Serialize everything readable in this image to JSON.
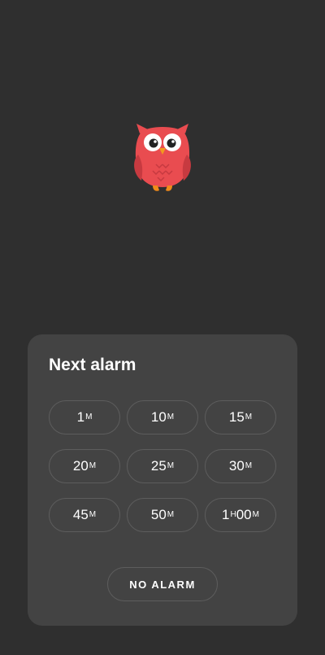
{
  "mascot": {
    "icon": "owl-icon",
    "colors": {
      "body": "#e94c50",
      "wing": "#c73a40",
      "beak": "#f39a1e",
      "feet": "#f08a1a"
    }
  },
  "sheet": {
    "title": "Next alarm",
    "options": [
      {
        "value": "1",
        "unit": "M"
      },
      {
        "value": "10",
        "unit": "M"
      },
      {
        "value": "15",
        "unit": "M"
      },
      {
        "value": "20",
        "unit": "M"
      },
      {
        "value": "25",
        "unit": "M"
      },
      {
        "value": "30",
        "unit": "M"
      },
      {
        "value": "45",
        "unit": "M"
      },
      {
        "value": "50",
        "unit": "M"
      },
      {
        "hours": "1",
        "hours_unit": "H",
        "value": "00",
        "unit": "M"
      }
    ],
    "no_alarm_label": "NO ALARM"
  }
}
